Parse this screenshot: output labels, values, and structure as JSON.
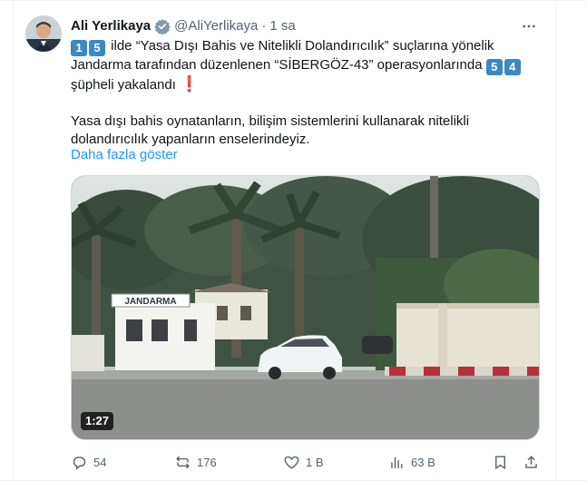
{
  "author": {
    "name": "Ali Yerlikaya",
    "handle": "@AliYerlikaya",
    "separator": "·",
    "time": "1 sa"
  },
  "tweet": {
    "line1_badge_a": "1",
    "line1_badge_b": "5",
    "line1_text": "ilde “Yasa Dışı Bahis ve Nitelikli Dolandırıcılık” suçlarına yönelik",
    "line2_text": "Jandarma tarafından düzenlenen “SİBERGÖZ-43” operasyonlarında",
    "line2_badge_a": "5",
    "line2_badge_b": "4",
    "line3_text": "şüpheli yakalandı",
    "line3_mark": "❗",
    "para2_line1": "Yasa dışı bahis oynatanların, bilişim sistemlerini kullanarak nitelikli",
    "para2_line2": "dolandırıcılık yapanların enselerindeyiz.",
    "show_more": "Daha fazla göster"
  },
  "media": {
    "duration": "1:27",
    "sign_text": "JANDARMA"
  },
  "actions": {
    "replies": "54",
    "reposts": "176",
    "likes": "1 B",
    "views": "63 B"
  },
  "colors": {
    "link": "#1d9bf0",
    "muted": "#536471",
    "badge": "#3b88c3",
    "verified": "#829aab"
  }
}
